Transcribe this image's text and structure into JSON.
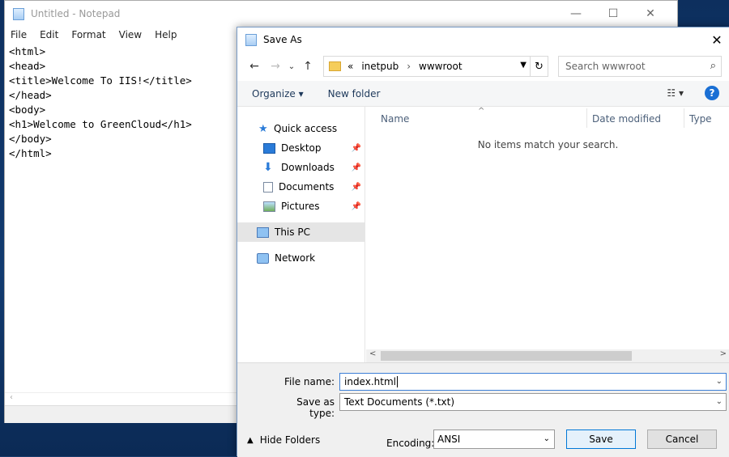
{
  "notepad": {
    "title": "Untitled - Notepad",
    "controls": {
      "minimize": "—",
      "maximize": "☐",
      "close": "✕"
    },
    "menu": [
      "File",
      "Edit",
      "Format",
      "View",
      "Help"
    ],
    "content": "<html>\n<head>\n<title>Welcome To IIS!</title>\n</head>\n<body>\n<h1>Welcome to GreenCloud</h1>\n</body>\n</html>"
  },
  "dialog": {
    "title": "Save As",
    "close": "✕",
    "nav": {
      "back": "←",
      "forward": "→",
      "recent": "⌄",
      "up": "↑"
    },
    "address": {
      "prefix": "«",
      "crumbs": [
        "inetpub",
        "wwwroot"
      ],
      "separator": "›",
      "refresh": "↻"
    },
    "search": {
      "placeholder": "Search wwwroot"
    },
    "toolbar": {
      "organize": "Organize ▾",
      "new_folder": "New folder",
      "help": "?"
    },
    "sidebar": [
      {
        "label": "Quick access",
        "icon": "star-icon",
        "pinned": false
      },
      {
        "label": "Desktop",
        "icon": "desktop-icon",
        "pinned": true
      },
      {
        "label": "Downloads",
        "icon": "download-icon",
        "pinned": true
      },
      {
        "label": "Documents",
        "icon": "document-icon",
        "pinned": true
      },
      {
        "label": "Pictures",
        "icon": "picture-icon",
        "pinned": true
      },
      {
        "label": "This PC",
        "icon": "computer-icon",
        "pinned": false,
        "selected": true
      },
      {
        "label": "Network",
        "icon": "network-icon",
        "pinned": false
      }
    ],
    "columns": [
      "Name",
      "Date modified",
      "Type"
    ],
    "empty_message": "No items match your search.",
    "file_name_label": "File name:",
    "file_name_value": "index.html",
    "save_type_label": "Save as type:",
    "save_type_value": "Text Documents (*.txt)",
    "hide_folders": "Hide Folders",
    "encoding_label": "Encoding:",
    "encoding_value": "ANSI",
    "save_button": "Save",
    "cancel_button": "Cancel"
  }
}
